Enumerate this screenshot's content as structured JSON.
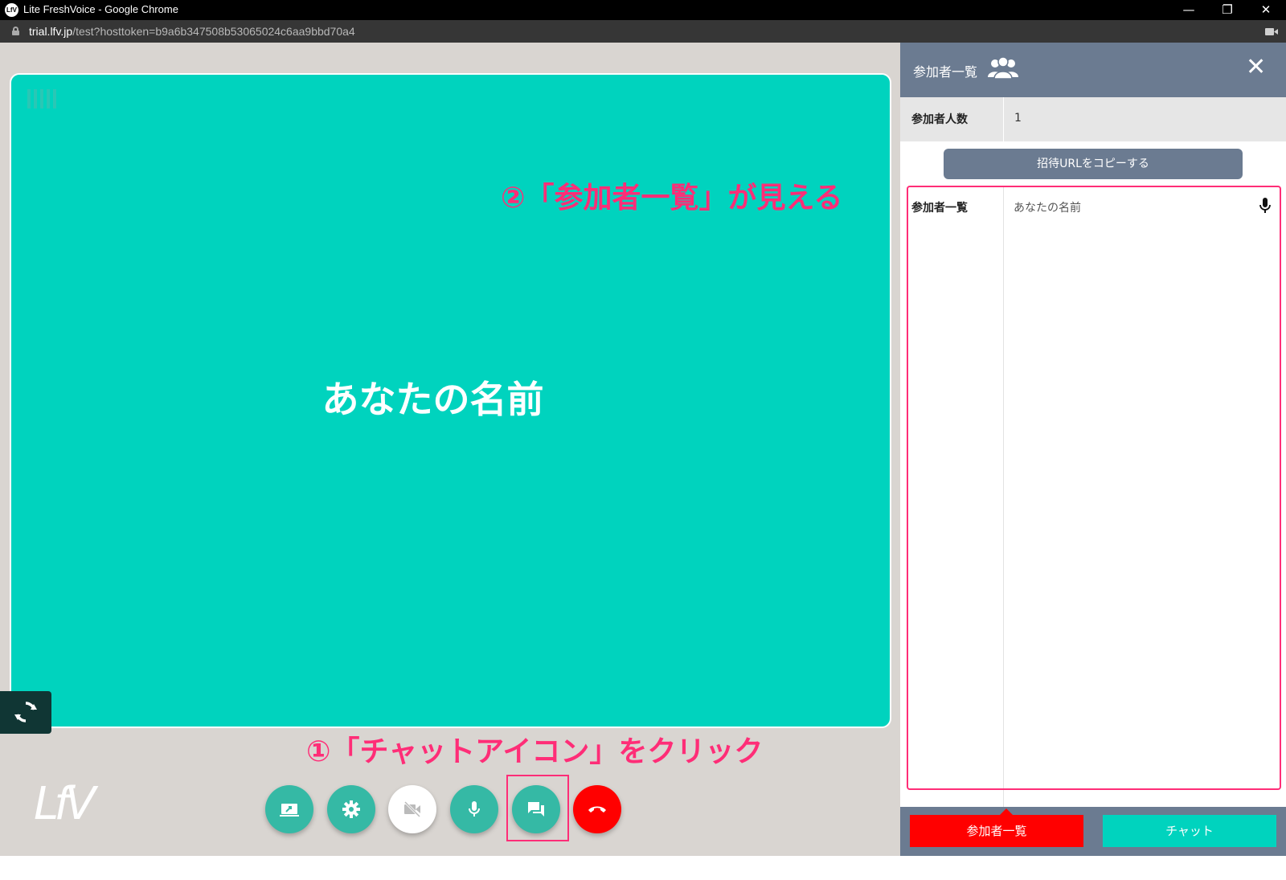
{
  "browser": {
    "window_title": "Lite FreshVoice - Google Chrome",
    "app_icon_text": "LfV",
    "url_host": "trial.lfv.jp",
    "url_path": "/test?hosttoken=b9a6b347508b53065024c6aa9bbd70a4",
    "controls": {
      "minimize": "—",
      "restore": "❐",
      "close": "✕"
    }
  },
  "video": {
    "participant_name": "あなたの名前",
    "tile_color": "#00d3be",
    "level_bars": 5
  },
  "annotations": {
    "step1": "①「チャットアイコン」をクリック",
    "step2": "②「参加者一覧」が見える",
    "color": "#ff2d77"
  },
  "logo": {
    "text": "LfV"
  },
  "controls": [
    {
      "name": "screen-share-button",
      "icon": "screen-share-icon"
    },
    {
      "name": "settings-button",
      "icon": "gear-icon"
    },
    {
      "name": "camera-off-button",
      "icon": "camera-off-icon"
    },
    {
      "name": "mic-button",
      "icon": "mic-icon"
    },
    {
      "name": "chat-button",
      "icon": "chat-icon"
    },
    {
      "name": "hangup-button",
      "icon": "phone-hangup-icon"
    }
  ],
  "panel": {
    "title": "参加者一覧",
    "close_label": "✕",
    "count_label": "参加者人数",
    "count_value": "1",
    "copy_button": "招待URLをコピーする",
    "list_label": "参加者一覧",
    "participants": [
      {
        "name": "あなたの名前",
        "mic": "on"
      }
    ],
    "tabs": {
      "participants": "参加者一覧",
      "chat": "チャット"
    },
    "header_color": "#6b7b91",
    "active_tab_color": "#ff0000",
    "chat_tab_color": "#00d3be"
  }
}
